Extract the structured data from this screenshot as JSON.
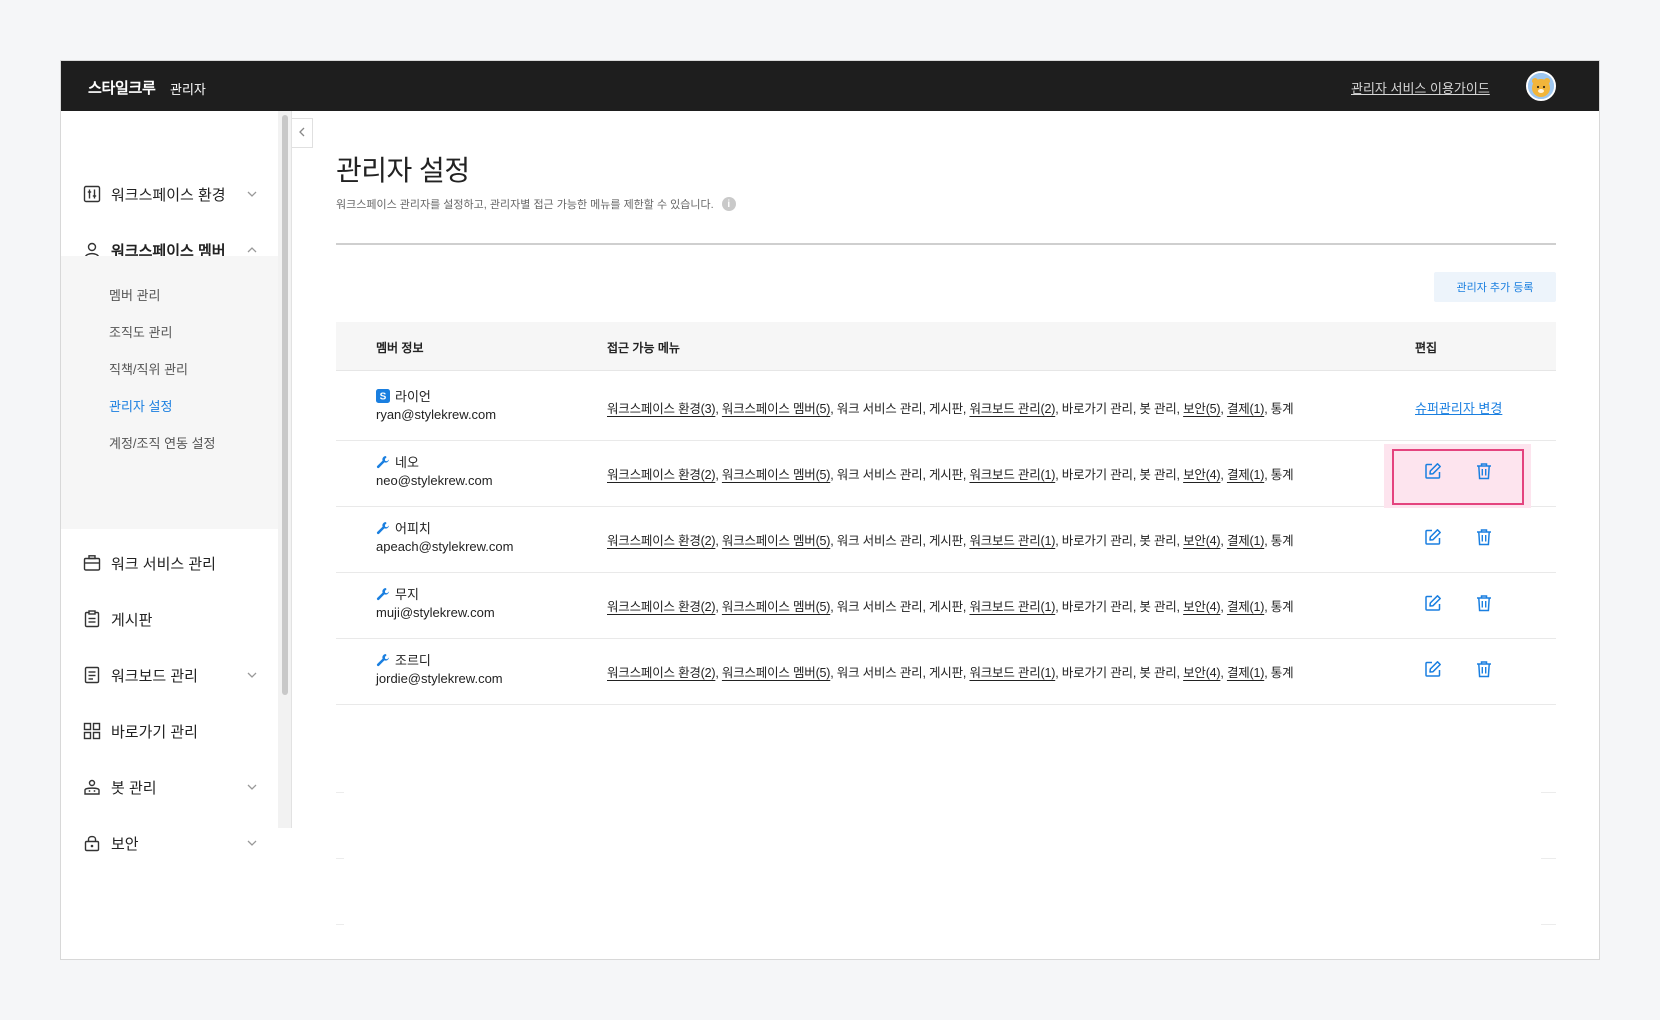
{
  "header": {
    "brand": "스타일크루",
    "brand_sub": "관리자",
    "guide_link": "관리자 서비스 이용가이드"
  },
  "sidebar": {
    "items": [
      {
        "label": "워크스페이스 환경",
        "icon": "sliders-icon"
      },
      {
        "label": "워크스페이스 멤버",
        "icon": "user-icon"
      },
      {
        "label": "워크 서비스 관리",
        "icon": "briefcase-icon"
      },
      {
        "label": "게시판",
        "icon": "clipboard-icon"
      },
      {
        "label": "워크보드 관리",
        "icon": "document-icon"
      },
      {
        "label": "바로가기 관리",
        "icon": "grid-icon"
      },
      {
        "label": "봇 관리",
        "icon": "bot-icon"
      },
      {
        "label": "보안",
        "icon": "lock-icon"
      }
    ],
    "sub_items": [
      "멤버 관리",
      "조직도 관리",
      "직책/직위 관리",
      "관리자 설정",
      "계정/조직 연동 설정"
    ],
    "active_sub": "관리자 설정"
  },
  "main": {
    "title": "관리자 설정",
    "description": "워크스페이스 관리자를 설정하고, 관리자별 접근 가능한 메뉴를 제한할 수 있습니다.",
    "info_glyph": "i",
    "add_button": "관리자 추가 등록",
    "table": {
      "headers": [
        "멤버 정보",
        "접근 가능 메뉴",
        "편집"
      ],
      "rows": [
        {
          "name": "라이언",
          "email": "ryan@stylekrew.com",
          "role": "super",
          "badge_letter": "S",
          "menus": [
            "워크스페이스 환경(3)",
            ", ",
            "워크스페이스 멤버(5)",
            ", 워크 서비스 관리, 게시판, ",
            "워크보드 관리(2)",
            ", 바로가기 관리, 봇 관리, ",
            "보안(5)",
            ", ",
            "결제(1)",
            ", 통계"
          ],
          "action": "슈퍼관리자 변경"
        },
        {
          "name": "네오",
          "email": "neo@stylekrew.com",
          "role": "admin",
          "menus": [
            "워크스페이스 환경(2)",
            ", ",
            "워크스페이스 멤버(5)",
            ", 워크 서비스 관리, 게시판, ",
            "워크보드 관리(1)",
            ", 바로가기 관리, 봇 관리, ",
            "보안(4)",
            ", ",
            "결제(1)",
            ", 통계"
          ]
        },
        {
          "name": "어피치",
          "email": "apeach@stylekrew.com",
          "role": "admin",
          "menus": [
            "워크스페이스 환경(2)",
            ", ",
            "워크스페이스 멤버(5)",
            ", 워크 서비스 관리, 게시판, ",
            "워크보드 관리(1)",
            ", 바로가기 관리, 봇 관리, ",
            "보안(4)",
            ", ",
            "결제(1)",
            ", 통계"
          ]
        },
        {
          "name": "무지",
          "email": "muji@stylekrew.com",
          "role": "admin",
          "menus": [
            "워크스페이스 환경(2)",
            ", ",
            "워크스페이스 멤버(5)",
            ", 워크 서비스 관리, 게시판, ",
            "워크보드 관리(1)",
            ", 바로가기 관리, 봇 관리, ",
            "보안(4)",
            ", ",
            "결제(1)",
            ", 통계"
          ]
        },
        {
          "name": "조르디",
          "email": "jordie@stylekrew.com",
          "role": "admin",
          "menus": [
            "워크스페이스 환경(2)",
            ", ",
            "워크스페이스 멤버(5)",
            ", 워크 서비스 관리, 게시판, ",
            "워크보드 관리(1)",
            ", 바로가기 관리, 봇 관리, ",
            "보안(4)",
            ", ",
            "결제(1)",
            ", 통계"
          ]
        }
      ]
    }
  },
  "colors": {
    "accent": "#1a7fe0",
    "topbar": "#1e1e1e",
    "highlight": "#e4437e"
  }
}
